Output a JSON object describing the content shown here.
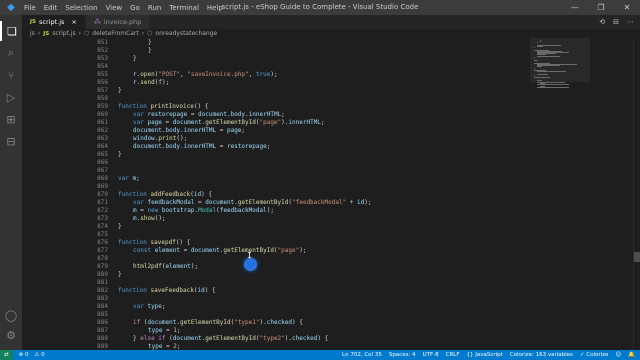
{
  "app": {
    "window_title": "script.js - eShop Guide to Complete - Visual Studio Code",
    "menu": [
      "File",
      "Edit",
      "Selection",
      "View",
      "Go",
      "Run",
      "Terminal",
      "Help"
    ],
    "window_controls": [
      "—",
      "❐",
      "✕"
    ]
  },
  "activity_bar": [
    {
      "name": "explorer-icon",
      "glyph": "❏"
    },
    {
      "name": "search-icon",
      "glyph": "⌕"
    },
    {
      "name": "source-control-icon",
      "glyph": "⑂"
    },
    {
      "name": "run-debug-icon",
      "glyph": "▷"
    },
    {
      "name": "extensions-icon",
      "glyph": "⊞"
    },
    {
      "name": "remote-explorer-icon",
      "glyph": "⊟"
    }
  ],
  "activity_bar_bottom": [
    {
      "name": "account-icon",
      "glyph": "◯"
    },
    {
      "name": "manage-gear-icon",
      "glyph": "⚙"
    }
  ],
  "tabs": [
    {
      "label": "script.js",
      "type": "JS",
      "active": true
    },
    {
      "label": "invoice.php",
      "type": "php",
      "active": false
    }
  ],
  "tab_actions": [
    "⟲",
    "⊟",
    "⋯"
  ],
  "breadcrumb": [
    "js",
    "script.js",
    "deleteFromCart",
    "onreadystatechange"
  ],
  "editor": {
    "lines": [
      {
        "n": "851",
        "indent": 2,
        "tokens": [
          [
            "pun",
            "}"
          ]
        ]
      },
      {
        "n": "852",
        "indent": 2,
        "tokens": [
          [
            "pun",
            "}"
          ]
        ]
      },
      {
        "n": "853",
        "indent": 1,
        "tokens": [
          [
            "pun",
            "}"
          ]
        ]
      },
      {
        "n": "854",
        "indent": 0,
        "tokens": []
      },
      {
        "n": "855",
        "indent": 1,
        "tokens": [
          [
            "var",
            "r"
          ],
          [
            "pun",
            "."
          ],
          [
            "fn",
            "open"
          ],
          [
            "pun",
            "("
          ],
          [
            "str",
            "\"POST\""
          ],
          [
            "pun",
            ", "
          ],
          [
            "str",
            "\"saveInvoice.php\""
          ],
          [
            "pun",
            ", "
          ],
          [
            "kw",
            "true"
          ],
          [
            "pun",
            ");"
          ]
        ]
      },
      {
        "n": "856",
        "indent": 1,
        "tokens": [
          [
            "var",
            "r"
          ],
          [
            "pun",
            "."
          ],
          [
            "fn",
            "send"
          ],
          [
            "pun",
            "("
          ],
          [
            "var",
            "f"
          ],
          [
            "pun",
            ");"
          ]
        ]
      },
      {
        "n": "857",
        "indent": 0,
        "tokens": [
          [
            "pun",
            "}"
          ]
        ]
      },
      {
        "n": "858",
        "indent": 0,
        "tokens": []
      },
      {
        "n": "859",
        "indent": 0,
        "tokens": [
          [
            "kw",
            "function "
          ],
          [
            "fn",
            "printInvoice"
          ],
          [
            "pun",
            "() {"
          ]
        ]
      },
      {
        "n": "860",
        "indent": 1,
        "tokens": [
          [
            "kw",
            "var "
          ],
          [
            "var",
            "restorepage"
          ],
          [
            "pun",
            " = "
          ],
          [
            "var",
            "document"
          ],
          [
            "pun",
            "."
          ],
          [
            "var",
            "body"
          ],
          [
            "pun",
            "."
          ],
          [
            "var",
            "innerHTML"
          ],
          [
            "pun",
            ";"
          ]
        ]
      },
      {
        "n": "861",
        "indent": 1,
        "tokens": [
          [
            "kw",
            "var "
          ],
          [
            "var",
            "page"
          ],
          [
            "pun",
            " = "
          ],
          [
            "var",
            "document"
          ],
          [
            "pun",
            "."
          ],
          [
            "fn",
            "getElementById"
          ],
          [
            "pun",
            "("
          ],
          [
            "str",
            "\"page\""
          ],
          [
            "pun",
            ")."
          ],
          [
            "var",
            "innerHTML"
          ],
          [
            "pun",
            ";"
          ]
        ]
      },
      {
        "n": "862",
        "indent": 1,
        "tokens": [
          [
            "var",
            "document"
          ],
          [
            "pun",
            "."
          ],
          [
            "var",
            "body"
          ],
          [
            "pun",
            "."
          ],
          [
            "var",
            "innerHTML"
          ],
          [
            "pun",
            " = "
          ],
          [
            "var",
            "page"
          ],
          [
            "pun",
            ";"
          ]
        ]
      },
      {
        "n": "863",
        "indent": 1,
        "tokens": [
          [
            "var",
            "window"
          ],
          [
            "pun",
            "."
          ],
          [
            "fn",
            "print"
          ],
          [
            "pun",
            "();"
          ]
        ]
      },
      {
        "n": "864",
        "indent": 1,
        "tokens": [
          [
            "var",
            "document"
          ],
          [
            "pun",
            "."
          ],
          [
            "var",
            "body"
          ],
          [
            "pun",
            "."
          ],
          [
            "var",
            "innerHTML"
          ],
          [
            "pun",
            " = "
          ],
          [
            "var",
            "restorepage"
          ],
          [
            "pun",
            ";"
          ]
        ]
      },
      {
        "n": "865",
        "indent": 0,
        "tokens": [
          [
            "pun",
            "}"
          ]
        ]
      },
      {
        "n": "866",
        "indent": 0,
        "tokens": []
      },
      {
        "n": "867",
        "indent": 0,
        "tokens": []
      },
      {
        "n": "868",
        "indent": 0,
        "tokens": [
          [
            "kw",
            "var "
          ],
          [
            "var",
            "m"
          ],
          [
            "pun",
            ";"
          ]
        ]
      },
      {
        "n": "869",
        "indent": 0,
        "tokens": []
      },
      {
        "n": "870",
        "indent": 0,
        "tokens": [
          [
            "kw",
            "function "
          ],
          [
            "fn",
            "addFeedback"
          ],
          [
            "pun",
            "("
          ],
          [
            "var",
            "id"
          ],
          [
            "pun",
            ") {"
          ]
        ]
      },
      {
        "n": "871",
        "indent": 1,
        "tokens": [
          [
            "kw",
            "var "
          ],
          [
            "var",
            "feedbackModal"
          ],
          [
            "pun",
            " = "
          ],
          [
            "var",
            "document"
          ],
          [
            "pun",
            "."
          ],
          [
            "fn",
            "getElementById"
          ],
          [
            "pun",
            "("
          ],
          [
            "str",
            "\"feedbackModal\""
          ],
          [
            "pun",
            " + "
          ],
          [
            "var",
            "id"
          ],
          [
            "pun",
            ");"
          ]
        ]
      },
      {
        "n": "872",
        "indent": 1,
        "tokens": [
          [
            "var",
            "m"
          ],
          [
            "pun",
            " = "
          ],
          [
            "kw",
            "new "
          ],
          [
            "var",
            "bootstrap"
          ],
          [
            "pun",
            "."
          ],
          [
            "cls",
            "Modal"
          ],
          [
            "pun",
            "("
          ],
          [
            "var",
            "feedbackModal"
          ],
          [
            "pun",
            ");"
          ]
        ]
      },
      {
        "n": "873",
        "indent": 1,
        "tokens": [
          [
            "var",
            "m"
          ],
          [
            "pun",
            "."
          ],
          [
            "fn",
            "show"
          ],
          [
            "pun",
            "();"
          ]
        ]
      },
      {
        "n": "874",
        "indent": 0,
        "tokens": [
          [
            "pun",
            "}"
          ]
        ]
      },
      {
        "n": "875",
        "indent": 0,
        "tokens": []
      },
      {
        "n": "876",
        "indent": 0,
        "tokens": [
          [
            "kw",
            "function "
          ],
          [
            "fn",
            "savepdf"
          ],
          [
            "pun",
            "() {"
          ]
        ]
      },
      {
        "n": "877",
        "indent": 1,
        "tokens": [
          [
            "kw",
            "const "
          ],
          [
            "var",
            "element"
          ],
          [
            "pun",
            " = "
          ],
          [
            "var",
            "document"
          ],
          [
            "pun",
            "."
          ],
          [
            "fn",
            "getElementById"
          ],
          [
            "pun",
            "("
          ],
          [
            "str",
            "\"page\""
          ],
          [
            "pun",
            ");"
          ]
        ]
      },
      {
        "n": "878",
        "indent": 0,
        "tokens": []
      },
      {
        "n": "879",
        "indent": 1,
        "tokens": [
          [
            "fn",
            "html2pdf"
          ],
          [
            "pun",
            "("
          ],
          [
            "var",
            "element"
          ],
          [
            "pun",
            ");"
          ]
        ]
      },
      {
        "n": "880",
        "indent": 0,
        "tokens": [
          [
            "pun",
            "}"
          ]
        ]
      },
      {
        "n": "881",
        "indent": 0,
        "tokens": []
      },
      {
        "n": "882",
        "indent": 0,
        "tokens": [
          [
            "kw",
            "function "
          ],
          [
            "fn",
            "saveFeedback"
          ],
          [
            "pun",
            "("
          ],
          [
            "var",
            "id"
          ],
          [
            "pun",
            ") {"
          ]
        ]
      },
      {
        "n": "883",
        "indent": 0,
        "tokens": []
      },
      {
        "n": "884",
        "indent": 1,
        "tokens": [
          [
            "kw",
            "var "
          ],
          [
            "var",
            "type"
          ],
          [
            "pun",
            ";"
          ]
        ]
      },
      {
        "n": "885",
        "indent": 0,
        "tokens": []
      },
      {
        "n": "886",
        "indent": 1,
        "tokens": [
          [
            "ctl",
            "if "
          ],
          [
            "pun",
            "("
          ],
          [
            "var",
            "document"
          ],
          [
            "pun",
            "."
          ],
          [
            "fn",
            "getElementById"
          ],
          [
            "pun",
            "("
          ],
          [
            "str",
            "\"type1\""
          ],
          [
            "pun",
            ")."
          ],
          [
            "var",
            "checked"
          ],
          [
            "pun",
            ") {"
          ]
        ]
      },
      {
        "n": "887",
        "indent": 2,
        "tokens": [
          [
            "var",
            "type"
          ],
          [
            "pun",
            " = "
          ],
          [
            "num",
            "1"
          ],
          [
            "pun",
            ";"
          ]
        ]
      },
      {
        "n": "888",
        "indent": 1,
        "tokens": [
          [
            "pun",
            "} "
          ],
          [
            "ctl",
            "else if "
          ],
          [
            "pun",
            "("
          ],
          [
            "var",
            "document"
          ],
          [
            "pun",
            "."
          ],
          [
            "fn",
            "getElementById"
          ],
          [
            "pun",
            "("
          ],
          [
            "str",
            "\"type2\""
          ],
          [
            "pun",
            ")."
          ],
          [
            "var",
            "checked"
          ],
          [
            "pun",
            ") {"
          ]
        ]
      },
      {
        "n": "889",
        "indent": 2,
        "tokens": [
          [
            "var",
            "type"
          ],
          [
            "pun",
            " = "
          ],
          [
            "num",
            "2"
          ],
          [
            "pun",
            ";"
          ]
        ]
      },
      {
        "n": "890",
        "indent": 1,
        "tokens": [
          [
            "pun",
            "} "
          ],
          [
            "ctl",
            "else if "
          ],
          [
            "pun",
            "("
          ],
          [
            "var",
            "document"
          ],
          [
            "pun",
            "."
          ],
          [
            "fn",
            "getElementById"
          ],
          [
            "pun",
            "("
          ],
          [
            "str",
            "\"type3\""
          ],
          [
            "pun",
            ")."
          ],
          [
            "var",
            "checked"
          ],
          [
            "pun",
            ") {"
          ]
        ]
      }
    ]
  },
  "status_bar": {
    "remote": "⇄",
    "errors": "⊗ 0",
    "warnings": "⚠ 0",
    "position": "Ln 702, Col 35",
    "spaces": "Spaces: 4",
    "encoding": "UTF-8",
    "eol": "CRLF",
    "language": "{} JavaScript",
    "colorize": "Colorize: 163 variables",
    "colorize_toggle": "✓ Colorize",
    "feedback": "☺",
    "bell": "🔔"
  },
  "colors": {
    "status_bar": "#007acc",
    "editor_bg": "#1e1e1e",
    "keyword": "#569cd6",
    "function": "#dcdcaa",
    "string": "#ce9178",
    "variable": "#9cdcfe"
  }
}
